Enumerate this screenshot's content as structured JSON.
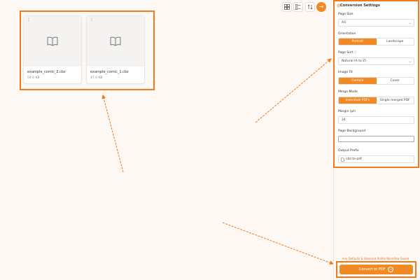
{
  "toolbar": {
    "grid_icon": "grid-icon",
    "list_icon": "list-icon",
    "sort_icon": "sort-icon",
    "next_icon": "arrow-right-icon"
  },
  "files": [
    {
      "name": "example_comic_2.cbz",
      "size": "54.0 KB"
    },
    {
      "name": "example_comic_1.cbz",
      "size": "47.0 KB"
    }
  ],
  "settings": {
    "title": "Conversion Settings",
    "page_size_label": "Page Size",
    "page_size_value": "A4",
    "orientation_label": "Orientation",
    "orientation_options": [
      "Portrait",
      "Landscape"
    ],
    "page_sort_label": "Page Sort",
    "page_sort_value": "Natural (A to Z)",
    "image_fit_label": "Image Fit",
    "image_fit_options": [
      "Contain",
      "Cover"
    ],
    "merge_mode_label": "Merge Mode",
    "merge_mode_options": [
      "Individual PDFs",
      "Single merged PDF"
    ],
    "margin_label": "Margin (pt)",
    "margin_value": "24",
    "page_background_label": "Page Background",
    "output_prefix_label": "Output Prefix",
    "output_prefix_value": "cbz-to-pdf"
  },
  "footer": {
    "hint": "Any Defaults & Selected Profile Workflow Saved",
    "convert_label": "Convert to PDF"
  },
  "colors": {
    "accent": "#f08a24",
    "highlight": "#f07a1e"
  }
}
